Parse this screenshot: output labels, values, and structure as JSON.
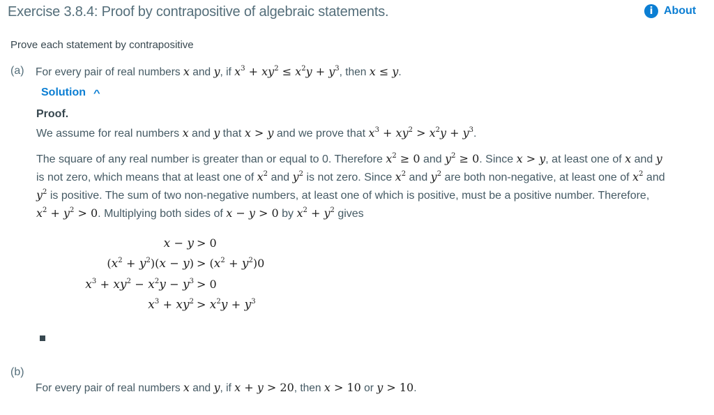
{
  "header": {
    "title": "Exercise 3.8.4: Proof by contrapositive of algebraic statements.",
    "about_label": "About",
    "about_icon": "info-icon",
    "accent_color": "#0b7ed3"
  },
  "intro": "Prove each statement by contrapositive",
  "parts": [
    {
      "label": "(a)",
      "statement": {
        "t1": "For every pair of real numbers ",
        "x": "x",
        "and": " and ",
        "y": "y",
        "t2": ", if ",
        "hyp": "x³ + xy² ≤ x²y + y³",
        "t3": ", then ",
        "concl": "x ≤ y",
        "end": "."
      },
      "solution_toggle": "Solution",
      "solution_toggle_icon": "chevron-up-icon",
      "proof_heading": "Proof.",
      "para1": {
        "t1": "We assume for real numbers ",
        "t2": " and ",
        "t3": " that ",
        "assume": "x > y",
        "t4": " and we prove that ",
        "goal": "x³ + xy² > x²y + y³",
        "end": "."
      },
      "para2": [
        "The square of any real number is greater than or equal to 0. Therefore x² ≥ 0 and y² ≥ 0. Since x > y, at least one of x and y",
        "is not zero, which means that at least one of x² and y² is not zero. Since x² and y² are both non-negative, at least one of x² and",
        "y² is positive. The sum of two non-negative numbers, at least one of which is positive, must be a positive number. Therefore,",
        "x² + y² > 0. Multiplying both sides of x − y > 0 by x² + y² gives"
      ],
      "equations": [
        {
          "left": "x − y",
          "right": "> 0"
        },
        {
          "left": "(x² + y²)(x − y)",
          "right": "> (x² + y²)0"
        },
        {
          "left": "x³ + xy² − x²y − y³",
          "right": "> 0"
        },
        {
          "left": "x³ + xy²",
          "right": "> x²y + y³"
        }
      ],
      "qed_icon": "qed-square-icon"
    },
    {
      "label": "(b)",
      "statement": {
        "t1": "For every pair of real numbers ",
        "x": "x",
        "and": " and ",
        "y": "y",
        "t2": ", if ",
        "hyp": "x + y > 20",
        "t3": ", then ",
        "concl1": "x > 10",
        "or": " or ",
        "concl2": "y > 10",
        "end": "."
      }
    }
  ]
}
